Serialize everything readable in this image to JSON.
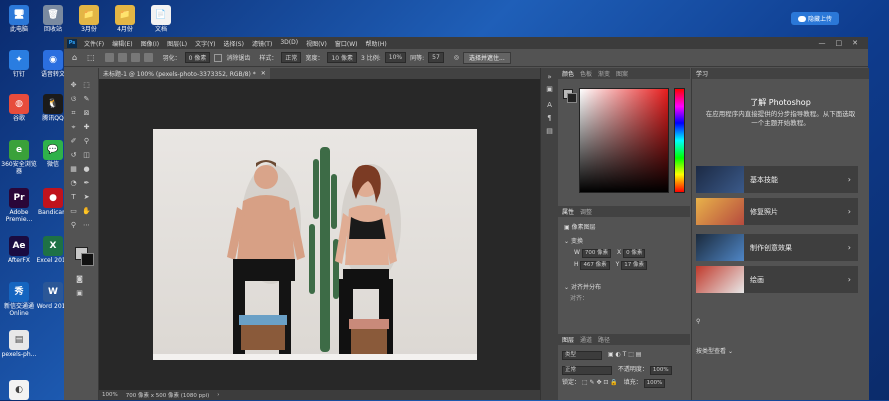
{
  "desktop": {
    "icons": [
      {
        "label": "此电脑",
        "glyph": "🖥",
        "color": "#2b78d8"
      },
      {
        "label": "回收站",
        "glyph": "🗑",
        "color": "#7a8aa0"
      },
      {
        "label": "3月份",
        "glyph": "📁",
        "color": "#e3b645"
      },
      {
        "label": "4月份",
        "glyph": "📁",
        "color": "#e3b645"
      },
      {
        "label": "文档",
        "glyph": "📄",
        "color": "#f2f2f2"
      },
      {
        "label": "钉钉",
        "glyph": "✦",
        "color": "#2a7de1"
      },
      {
        "label": "语音转文",
        "glyph": "◉",
        "color": "#2b6fe0"
      },
      {
        "label": "谷歌",
        "glyph": "◍",
        "color": "#e74c3c"
      },
      {
        "label": "腾讯QQ",
        "glyph": "🐧",
        "color": "#1b1b1b"
      },
      {
        "label": "360安全浏览器",
        "glyph": "e",
        "color": "#3aa13a"
      },
      {
        "label": "微信",
        "glyph": "💬",
        "color": "#2fb14a"
      },
      {
        "label": "Adobe Premie...",
        "glyph": "Pr",
        "color": "#2a0638"
      },
      {
        "label": "Bandicam",
        "glyph": "●",
        "color": "#c0131d"
      },
      {
        "label": "AfterFX",
        "glyph": "Ae",
        "color": "#1a0b40"
      },
      {
        "label": "Excel 2016",
        "glyph": "X",
        "color": "#1e7145"
      },
      {
        "label": "新信交通通 Online",
        "glyph": "秀",
        "color": "#1565c0"
      },
      {
        "label": "Word 2016",
        "glyph": "W",
        "color": "#2b5797"
      },
      {
        "label": "pexels-ph...",
        "glyph": "▤",
        "color": "#e8e8e8"
      },
      {
        "label": "",
        "glyph": "◐",
        "color": "#f3f3f3"
      }
    ],
    "cloud_button": "隐藏上传"
  },
  "ps": {
    "logo": "Ps",
    "menu": [
      "文件(F)",
      "编辑(E)",
      "图像(I)",
      "图层(L)",
      "文字(Y)",
      "选择(S)",
      "滤镜(T)",
      "3D(D)",
      "视图(V)",
      "窗口(W)",
      "帮助(H)"
    ],
    "window_controls": [
      "—",
      "□",
      "✕"
    ],
    "options": {
      "feather_label": "羽化：",
      "feather_value": "0 像素",
      "antialias": "消除锯齿",
      "style_label": "样式：",
      "style_value": "正常",
      "width_label": "宽度：",
      "height_label": "高度：",
      "select_subject": "选择并遮住..."
    },
    "options_full": [
      "0 像素",
      "消除锯齿",
      "正常",
      "宽度:",
      "10 像素",
      "3 比例:",
      "10%",
      "同等:",
      "57"
    ],
    "doc_tab": "未标题-1 @ 100% (pexels-photo-3373352, RGB/8) *",
    "doc_tab_close": "✕",
    "status": {
      "zoom": "100%",
      "info": "700 像素 x 500 像素 (1080 ppi)"
    },
    "color_panel": {
      "tabs": [
        "颜色",
        "色板",
        "渐变",
        "图案"
      ]
    },
    "properties": {
      "tabs": [
        "属性",
        "调整"
      ],
      "layer_type": "像素图层",
      "transform_label": "变换",
      "w_label": "W",
      "w_value": "700 像素",
      "x_label": "X",
      "x_value": "0 像素",
      "h_label": "H",
      "h_value": "467 像素",
      "y_label": "Y",
      "y_value": "17 像素",
      "align_label": "对齐并分布",
      "align_sub": "对齐："
    },
    "layers": {
      "tabs": [
        "图层",
        "通道",
        "路径"
      ],
      "kind": "类型",
      "blend": "正常",
      "opacity_label": "不透明度：",
      "opacity_value": "100%",
      "lock_label": "锁定：",
      "fill_label": "填充：",
      "fill_value": "100%"
    },
    "learn": {
      "tab": "学习",
      "title": "了解 Photoshop",
      "description": "在应用程序内直接提供的分步指导教程。从下面选取一个主题开始教程。",
      "cards": [
        {
          "label": "基本技能",
          "colors": [
            "#1c2a44",
            "#3b5a8a"
          ]
        },
        {
          "label": "修复照片",
          "colors": [
            "#e8b24a",
            "#b64a3e"
          ]
        },
        {
          "label": "制作创意效果",
          "colors": [
            "#1b2a3c",
            "#4f86c6"
          ]
        },
        {
          "label": "绘画",
          "colors": [
            "#c0392b",
            "#e8e8e8"
          ]
        }
      ],
      "search_placeholder": "",
      "filter_label": "按类型查看"
    }
  }
}
